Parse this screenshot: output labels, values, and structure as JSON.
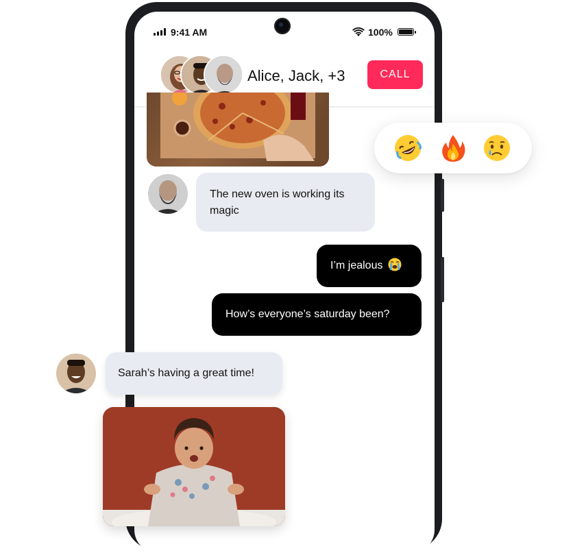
{
  "status_bar": {
    "time": "9:41 AM",
    "battery": "100%"
  },
  "header": {
    "title": "Alice, Jack, +3",
    "call_label": "CALL",
    "participants": [
      "participant-woman",
      "participant-man",
      "participant-bald-man"
    ]
  },
  "messages": [
    {
      "type": "image",
      "from": "bald-man",
      "description_icon": "pizza-photo"
    },
    {
      "type": "text",
      "direction": "in",
      "lines": [
        "The new oven is working its",
        "magic"
      ]
    },
    {
      "type": "text",
      "direction": "out",
      "text": "I’m jealous",
      "emoji": "loudly-crying-emoji"
    },
    {
      "type": "text",
      "direction": "out",
      "text": "How’s everyone’s saturday been?"
    },
    {
      "type": "text",
      "direction": "in",
      "text": "Sarah’s having a great time!"
    },
    {
      "type": "image",
      "from": "man",
      "description_icon": "baby-photo"
    }
  ],
  "reactions": [
    "rolling-laughing-emoji",
    "fire-emoji",
    "crying-face-emoji"
  ],
  "colors": {
    "call": "#ff2a5a",
    "bubble_in": "#e8ebf1",
    "bubble_out": "#000000",
    "phone_frame": "#1c1d20"
  }
}
